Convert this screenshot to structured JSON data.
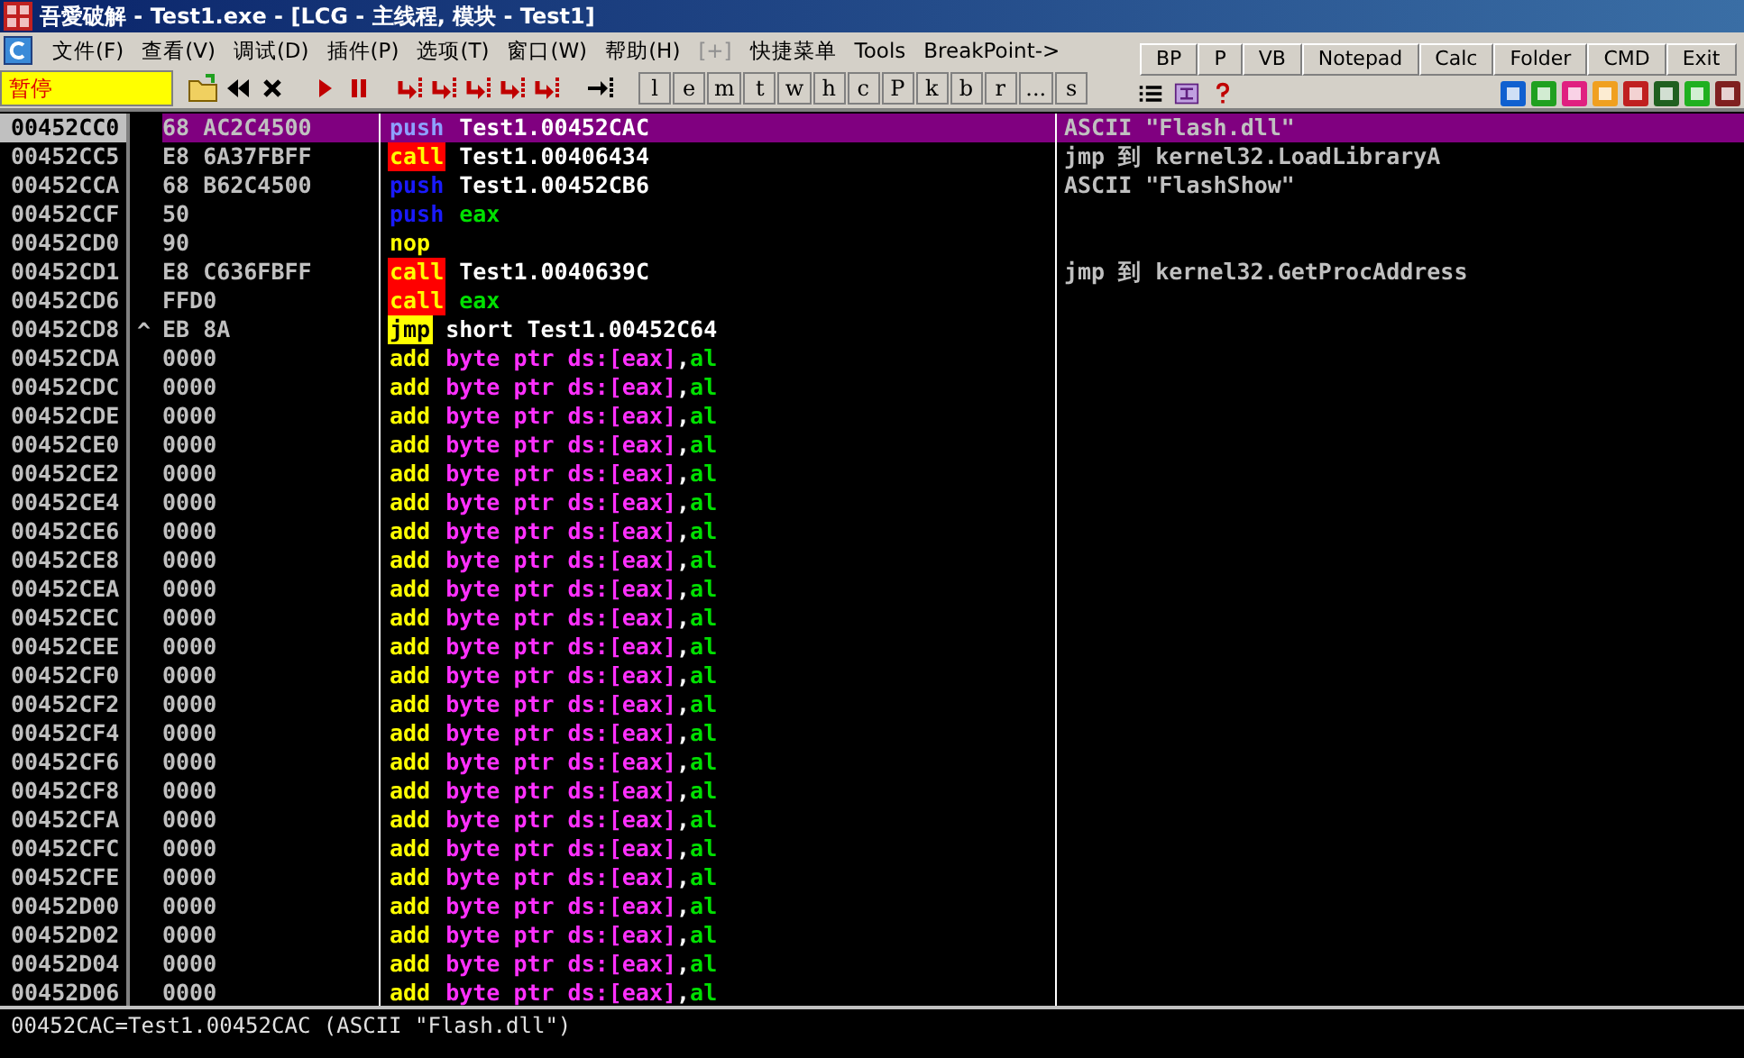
{
  "window": {
    "title": "吾愛破解 - Test1.exe - [LCG - 主线程, 模块 - Test1]"
  },
  "menu": [
    {
      "label": "文件(F)",
      "disabled": false
    },
    {
      "label": "查看(V)",
      "disabled": false
    },
    {
      "label": "调试(D)",
      "disabled": false
    },
    {
      "label": "插件(P)",
      "disabled": false
    },
    {
      "label": "选项(T)",
      "disabled": false
    },
    {
      "label": "窗口(W)",
      "disabled": false
    },
    {
      "label": "帮助(H)",
      "disabled": false
    },
    {
      "label": "[+]",
      "disabled": true
    },
    {
      "label": "快捷菜单",
      "disabled": false
    },
    {
      "label": "Tools",
      "disabled": false
    },
    {
      "label": "BreakPoint->",
      "disabled": false
    }
  ],
  "status": "暂停",
  "letter_buttons": [
    "l",
    "e",
    "m",
    "t",
    "w",
    "h",
    "c",
    "P",
    "k",
    "b",
    "r",
    "...",
    "s"
  ],
  "quick_buttons": [
    "BP",
    "P",
    "VB",
    "Notepad",
    "Calc",
    "Folder",
    "CMD",
    "Exit"
  ],
  "rows": [
    {
      "address": "00452CC0",
      "hex": "68 AC2C4500",
      "mnemonic": "push",
      "kind": "push",
      "operands": [
        {
          "text": "Test1.00452CAC",
          "kind": "address"
        }
      ],
      "comment": "ASCII \"Flash.dll\"",
      "selected": true
    },
    {
      "address": "00452CC5",
      "hex": "E8 6A37FBFF",
      "mnemonic": "call",
      "kind": "call",
      "operands": [
        {
          "text": "Test1.00406434",
          "kind": "address"
        }
      ],
      "comment": "jmp 到 kernel32.LoadLibraryA",
      "selected": false
    },
    {
      "address": "00452CCA",
      "hex": "68 B62C4500",
      "mnemonic": "push",
      "kind": "push",
      "operands": [
        {
          "text": "Test1.00452CB6",
          "kind": "address"
        }
      ],
      "comment": "ASCII \"FlashShow\"",
      "selected": false
    },
    {
      "address": "00452CCF",
      "hex": "50",
      "mnemonic": "push",
      "kind": "push",
      "operands": [
        {
          "text": "eax",
          "kind": "register"
        }
      ],
      "selected": false
    },
    {
      "address": "00452CD0",
      "hex": "90",
      "mnemonic": "nop",
      "kind": "plain",
      "operands": [],
      "selected": false
    },
    {
      "address": "00452CD1",
      "hex": "E8 C636FBFF",
      "mnemonic": "call",
      "kind": "call",
      "operands": [
        {
          "text": "Test1.0040639C",
          "kind": "address"
        }
      ],
      "comment": "jmp 到 kernel32.GetProcAddress",
      "selected": false
    },
    {
      "address": "00452CD6",
      "hex": "FFD0",
      "mnemonic": "call",
      "kind": "call",
      "operands": [
        {
          "text": "eax",
          "kind": "register"
        }
      ],
      "selected": false
    },
    {
      "address": "00452CD8",
      "jump_mark": "^",
      "hex": "EB 8A",
      "mnemonic": "jmp",
      "kind": "jump",
      "operands": [
        {
          "text": "short Test1.00452C64",
          "kind": "address"
        }
      ],
      "selected": false
    },
    {
      "address": "00452CDA",
      "hex": "0000",
      "mnemonic": "add",
      "kind": "plain",
      "operands": [
        {
          "text": "byte ptr ds:[eax]",
          "kind": "memory"
        },
        {
          "text": ",",
          "kind": "plain"
        },
        {
          "text": "al",
          "kind": "register"
        }
      ],
      "selected": false
    },
    {
      "address": "00452CDC",
      "hex": "0000",
      "mnemonic": "add",
      "kind": "plain",
      "operands": [
        {
          "text": "byte ptr ds:[eax]",
          "kind": "memory"
        },
        {
          "text": ",",
          "kind": "plain"
        },
        {
          "text": "al",
          "kind": "register"
        }
      ],
      "selected": false
    },
    {
      "address": "00452CDE",
      "hex": "0000",
      "mnemonic": "add",
      "kind": "plain",
      "operands": [
        {
          "text": "byte ptr ds:[eax]",
          "kind": "memory"
        },
        {
          "text": ",",
          "kind": "plain"
        },
        {
          "text": "al",
          "kind": "register"
        }
      ],
      "selected": false
    },
    {
      "address": "00452CE0",
      "hex": "0000",
      "mnemonic": "add",
      "kind": "plain",
      "operands": [
        {
          "text": "byte ptr ds:[eax]",
          "kind": "memory"
        },
        {
          "text": ",",
          "kind": "plain"
        },
        {
          "text": "al",
          "kind": "register"
        }
      ],
      "selected": false
    },
    {
      "address": "00452CE2",
      "hex": "0000",
      "mnemonic": "add",
      "kind": "plain",
      "operands": [
        {
          "text": "byte ptr ds:[eax]",
          "kind": "memory"
        },
        {
          "text": ",",
          "kind": "plain"
        },
        {
          "text": "al",
          "kind": "register"
        }
      ],
      "selected": false
    },
    {
      "address": "00452CE4",
      "hex": "0000",
      "mnemonic": "add",
      "kind": "plain",
      "operands": [
        {
          "text": "byte ptr ds:[eax]",
          "kind": "memory"
        },
        {
          "text": ",",
          "kind": "plain"
        },
        {
          "text": "al",
          "kind": "register"
        }
      ],
      "selected": false
    },
    {
      "address": "00452CE6",
      "hex": "0000",
      "mnemonic": "add",
      "kind": "plain",
      "operands": [
        {
          "text": "byte ptr ds:[eax]",
          "kind": "memory"
        },
        {
          "text": ",",
          "kind": "plain"
        },
        {
          "text": "al",
          "kind": "register"
        }
      ],
      "selected": false
    },
    {
      "address": "00452CE8",
      "hex": "0000",
      "mnemonic": "add",
      "kind": "plain",
      "operands": [
        {
          "text": "byte ptr ds:[eax]",
          "kind": "memory"
        },
        {
          "text": ",",
          "kind": "plain"
        },
        {
          "text": "al",
          "kind": "register"
        }
      ],
      "selected": false
    },
    {
      "address": "00452CEA",
      "hex": "0000",
      "mnemonic": "add",
      "kind": "plain",
      "operands": [
        {
          "text": "byte ptr ds:[eax]",
          "kind": "memory"
        },
        {
          "text": ",",
          "kind": "plain"
        },
        {
          "text": "al",
          "kind": "register"
        }
      ],
      "selected": false
    },
    {
      "address": "00452CEC",
      "hex": "0000",
      "mnemonic": "add",
      "kind": "plain",
      "operands": [
        {
          "text": "byte ptr ds:[eax]",
          "kind": "memory"
        },
        {
          "text": ",",
          "kind": "plain"
        },
        {
          "text": "al",
          "kind": "register"
        }
      ],
      "selected": false
    },
    {
      "address": "00452CEE",
      "hex": "0000",
      "mnemonic": "add",
      "kind": "plain",
      "operands": [
        {
          "text": "byte ptr ds:[eax]",
          "kind": "memory"
        },
        {
          "text": ",",
          "kind": "plain"
        },
        {
          "text": "al",
          "kind": "register"
        }
      ],
      "selected": false
    },
    {
      "address": "00452CF0",
      "hex": "0000",
      "mnemonic": "add",
      "kind": "plain",
      "operands": [
        {
          "text": "byte ptr ds:[eax]",
          "kind": "memory"
        },
        {
          "text": ",",
          "kind": "plain"
        },
        {
          "text": "al",
          "kind": "register"
        }
      ],
      "selected": false
    },
    {
      "address": "00452CF2",
      "hex": "0000",
      "mnemonic": "add",
      "kind": "plain",
      "operands": [
        {
          "text": "byte ptr ds:[eax]",
          "kind": "memory"
        },
        {
          "text": ",",
          "kind": "plain"
        },
        {
          "text": "al",
          "kind": "register"
        }
      ],
      "selected": false
    },
    {
      "address": "00452CF4",
      "hex": "0000",
      "mnemonic": "add",
      "kind": "plain",
      "operands": [
        {
          "text": "byte ptr ds:[eax]",
          "kind": "memory"
        },
        {
          "text": ",",
          "kind": "plain"
        },
        {
          "text": "al",
          "kind": "register"
        }
      ],
      "selected": false
    },
    {
      "address": "00452CF6",
      "hex": "0000",
      "mnemonic": "add",
      "kind": "plain",
      "operands": [
        {
          "text": "byte ptr ds:[eax]",
          "kind": "memory"
        },
        {
          "text": ",",
          "kind": "plain"
        },
        {
          "text": "al",
          "kind": "register"
        }
      ],
      "selected": false
    },
    {
      "address": "00452CF8",
      "hex": "0000",
      "mnemonic": "add",
      "kind": "plain",
      "operands": [
        {
          "text": "byte ptr ds:[eax]",
          "kind": "memory"
        },
        {
          "text": ",",
          "kind": "plain"
        },
        {
          "text": "al",
          "kind": "register"
        }
      ],
      "selected": false
    },
    {
      "address": "00452CFA",
      "hex": "0000",
      "mnemonic": "add",
      "kind": "plain",
      "operands": [
        {
          "text": "byte ptr ds:[eax]",
          "kind": "memory"
        },
        {
          "text": ",",
          "kind": "plain"
        },
        {
          "text": "al",
          "kind": "register"
        }
      ],
      "selected": false
    },
    {
      "address": "00452CFC",
      "hex": "0000",
      "mnemonic": "add",
      "kind": "plain",
      "operands": [
        {
          "text": "byte ptr ds:[eax]",
          "kind": "memory"
        },
        {
          "text": ",",
          "kind": "plain"
        },
        {
          "text": "al",
          "kind": "register"
        }
      ],
      "selected": false
    },
    {
      "address": "00452CFE",
      "hex": "0000",
      "mnemonic": "add",
      "kind": "plain",
      "operands": [
        {
          "text": "byte ptr ds:[eax]",
          "kind": "memory"
        },
        {
          "text": ",",
          "kind": "plain"
        },
        {
          "text": "al",
          "kind": "register"
        }
      ],
      "selected": false
    },
    {
      "address": "00452D00",
      "hex": "0000",
      "mnemonic": "add",
      "kind": "plain",
      "operands": [
        {
          "text": "byte ptr ds:[eax]",
          "kind": "memory"
        },
        {
          "text": ",",
          "kind": "plain"
        },
        {
          "text": "al",
          "kind": "register"
        }
      ],
      "selected": false
    },
    {
      "address": "00452D02",
      "hex": "0000",
      "mnemonic": "add",
      "kind": "plain",
      "operands": [
        {
          "text": "byte ptr ds:[eax]",
          "kind": "memory"
        },
        {
          "text": ",",
          "kind": "plain"
        },
        {
          "text": "al",
          "kind": "register"
        }
      ],
      "selected": false
    },
    {
      "address": "00452D04",
      "hex": "0000",
      "mnemonic": "add",
      "kind": "plain",
      "operands": [
        {
          "text": "byte ptr ds:[eax]",
          "kind": "memory"
        },
        {
          "text": ",",
          "kind": "plain"
        },
        {
          "text": "al",
          "kind": "register"
        }
      ],
      "selected": false
    },
    {
      "address": "00452D06",
      "hex": "0000",
      "mnemonic": "add",
      "kind": "plain",
      "operands": [
        {
          "text": "byte ptr ds:[eax]",
          "kind": "memory"
        },
        {
          "text": ",",
          "kind": "plain"
        },
        {
          "text": "al",
          "kind": "register"
        }
      ],
      "selected": false
    }
  ],
  "info_line": "00452CAC=Test1.00452CAC (ASCII \"Flash.dll\")"
}
